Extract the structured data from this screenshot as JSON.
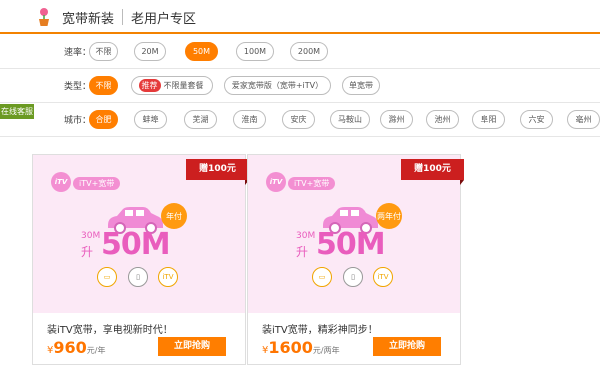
{
  "header": {
    "title": "宽带新装",
    "subtitle": "老用户专区"
  },
  "filters": {
    "speed": {
      "label": "速率：",
      "options": [
        "不限",
        "20M",
        "50M",
        "100M",
        "200M"
      ],
      "selected": "50M"
    },
    "type": {
      "label": "类型：",
      "options": [
        "不限",
        "推荐",
        "不限量套餐",
        "爱家宽带版（宽带+iTV）",
        "单宽带"
      ],
      "selected": "不限"
    },
    "city": {
      "label": "城市：",
      "options": [
        "合肥",
        "蚌埠",
        "芜湖",
        "淮南",
        "安庆",
        "马鞍山",
        "滁州",
        "池州",
        "阜阳",
        "六安",
        "亳州"
      ],
      "selected": "合肥"
    }
  },
  "service_tab": "在线客服",
  "cards": [
    {
      "tag": "iTV+宽带",
      "gift": "赠100元",
      "plan": "年付",
      "from_speed": "30M",
      "up": "升",
      "speed": "50M",
      "description": "装iTV宽带，享电视新时代！",
      "price_symbol": "¥",
      "price": "960",
      "price_unit": "元/年",
      "buy_label": "立即抢购",
      "icons": [
        "tv-icon",
        "phone-icon",
        "itv-icon"
      ]
    },
    {
      "tag": "iTV+宽带",
      "gift": "赠100元",
      "plan": "两年付",
      "from_speed": "30M",
      "up": "升",
      "speed": "50M",
      "description": "装iTV宽带，精彩神同步！",
      "price_symbol": "¥",
      "price": "1600",
      "price_unit": "元/两年",
      "buy_label": "立即抢购",
      "icons": [
        "tv-icon",
        "phone-icon",
        "itv-icon"
      ]
    }
  ],
  "colors": {
    "accent": "#ff7e00",
    "pink": "#e95dbd",
    "badge_red": "#cc1f1f",
    "service_green": "#6b9a22"
  }
}
